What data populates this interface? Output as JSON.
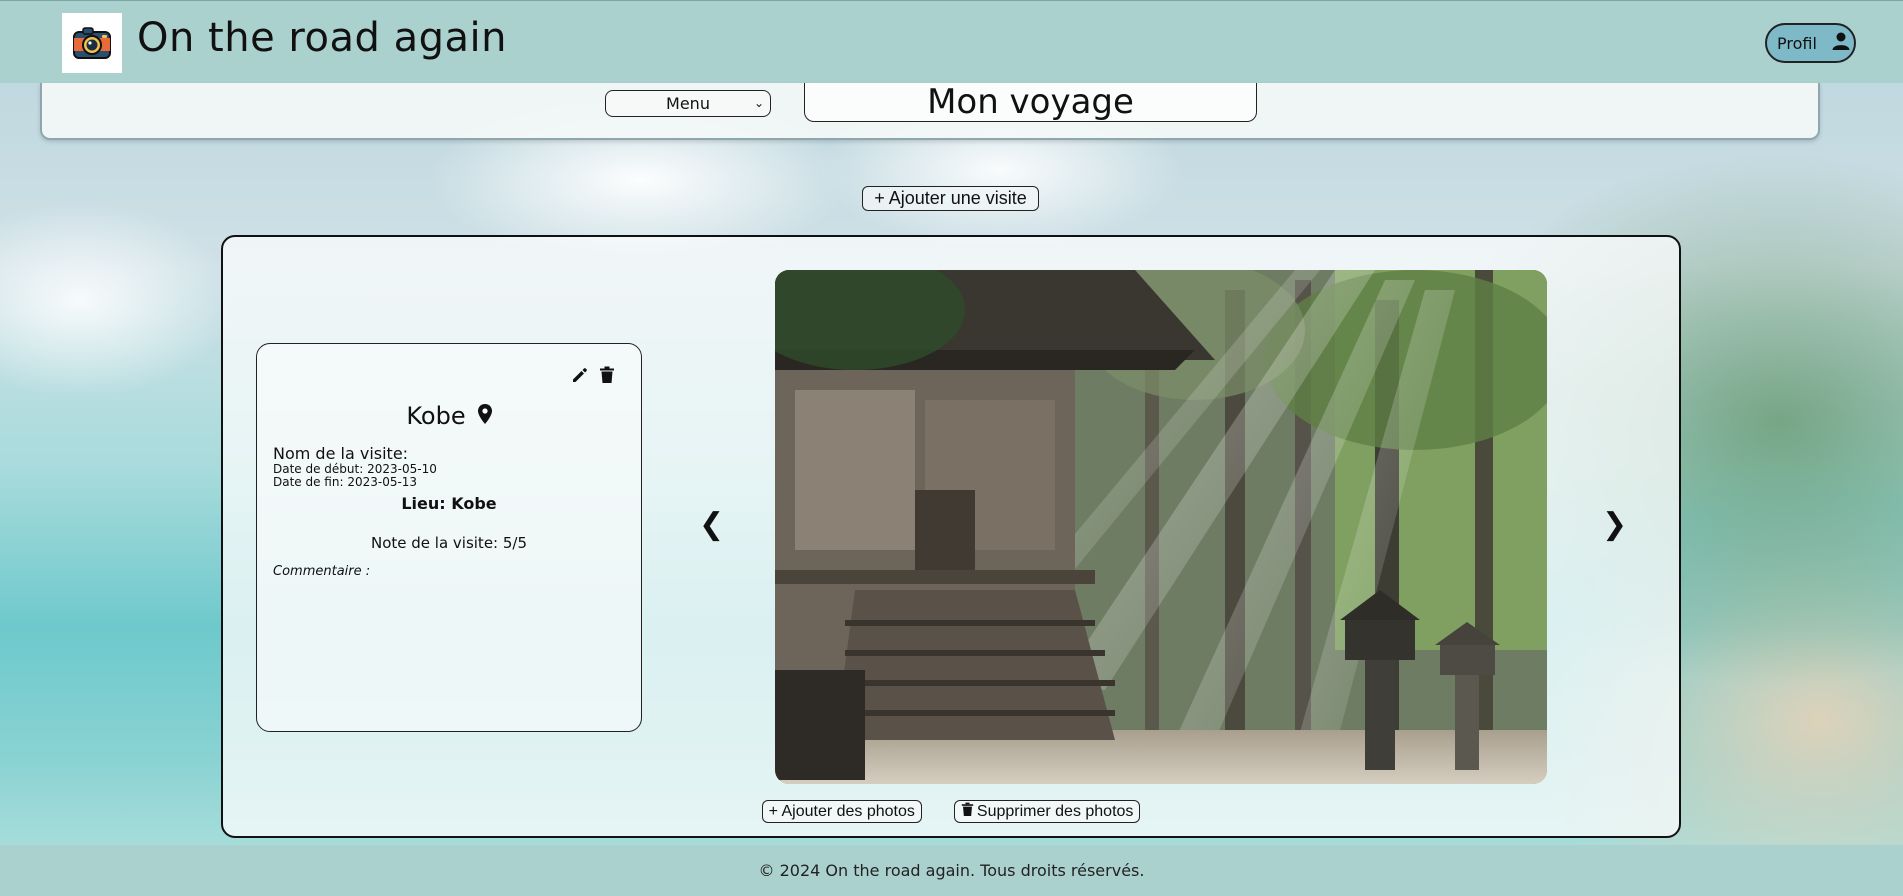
{
  "header": {
    "app_title": "On the road again",
    "profile_label": "Profil",
    "logo_icon": "camera-icon"
  },
  "toolbar": {
    "menu_selected": "Menu",
    "trip_title": "Mon voyage"
  },
  "actions": {
    "add_visit": "+ Ajouter une visite",
    "add_photos": "+ Ajouter des photos",
    "delete_photos": "Supprimer des photos"
  },
  "visit": {
    "city": "Kobe",
    "name_label": "Nom de la visite:",
    "start_date": "Date de début: 2023-05-10",
    "end_date": "Date de fin: 2023-05-13",
    "place": "Lieu: Kobe",
    "rating": "Note de la visite: 5/5",
    "comment": "Commentaire :"
  },
  "carousel": {
    "prev": "❮",
    "next": "❯"
  },
  "footer": {
    "copyright": "© 2024 On the road again. Tous droits réservés."
  },
  "colors": {
    "header_bg": "#abd1cf",
    "profile_bg": "#7eb9c7"
  }
}
